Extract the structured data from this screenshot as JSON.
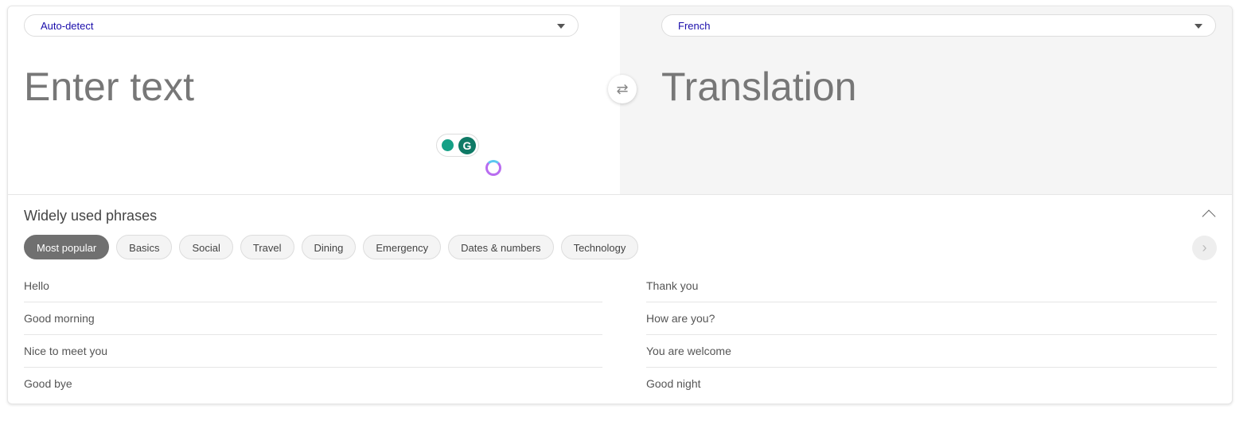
{
  "source": {
    "language": "Auto-detect",
    "placeholder": "Enter text"
  },
  "target": {
    "language": "French",
    "placeholder": "Translation"
  },
  "swap_icon": "swap-arrows-icon",
  "phrases": {
    "title": "Widely used phrases",
    "categories": [
      "Most popular",
      "Basics",
      "Social",
      "Travel",
      "Dining",
      "Emergency",
      "Dates & numbers",
      "Technology"
    ],
    "active_category": "Most popular",
    "left": [
      "Hello",
      "Good morning",
      "Nice to meet you",
      "Good bye"
    ],
    "right": [
      "Thank you",
      "How are you?",
      "You are welcome",
      "Good night"
    ]
  }
}
